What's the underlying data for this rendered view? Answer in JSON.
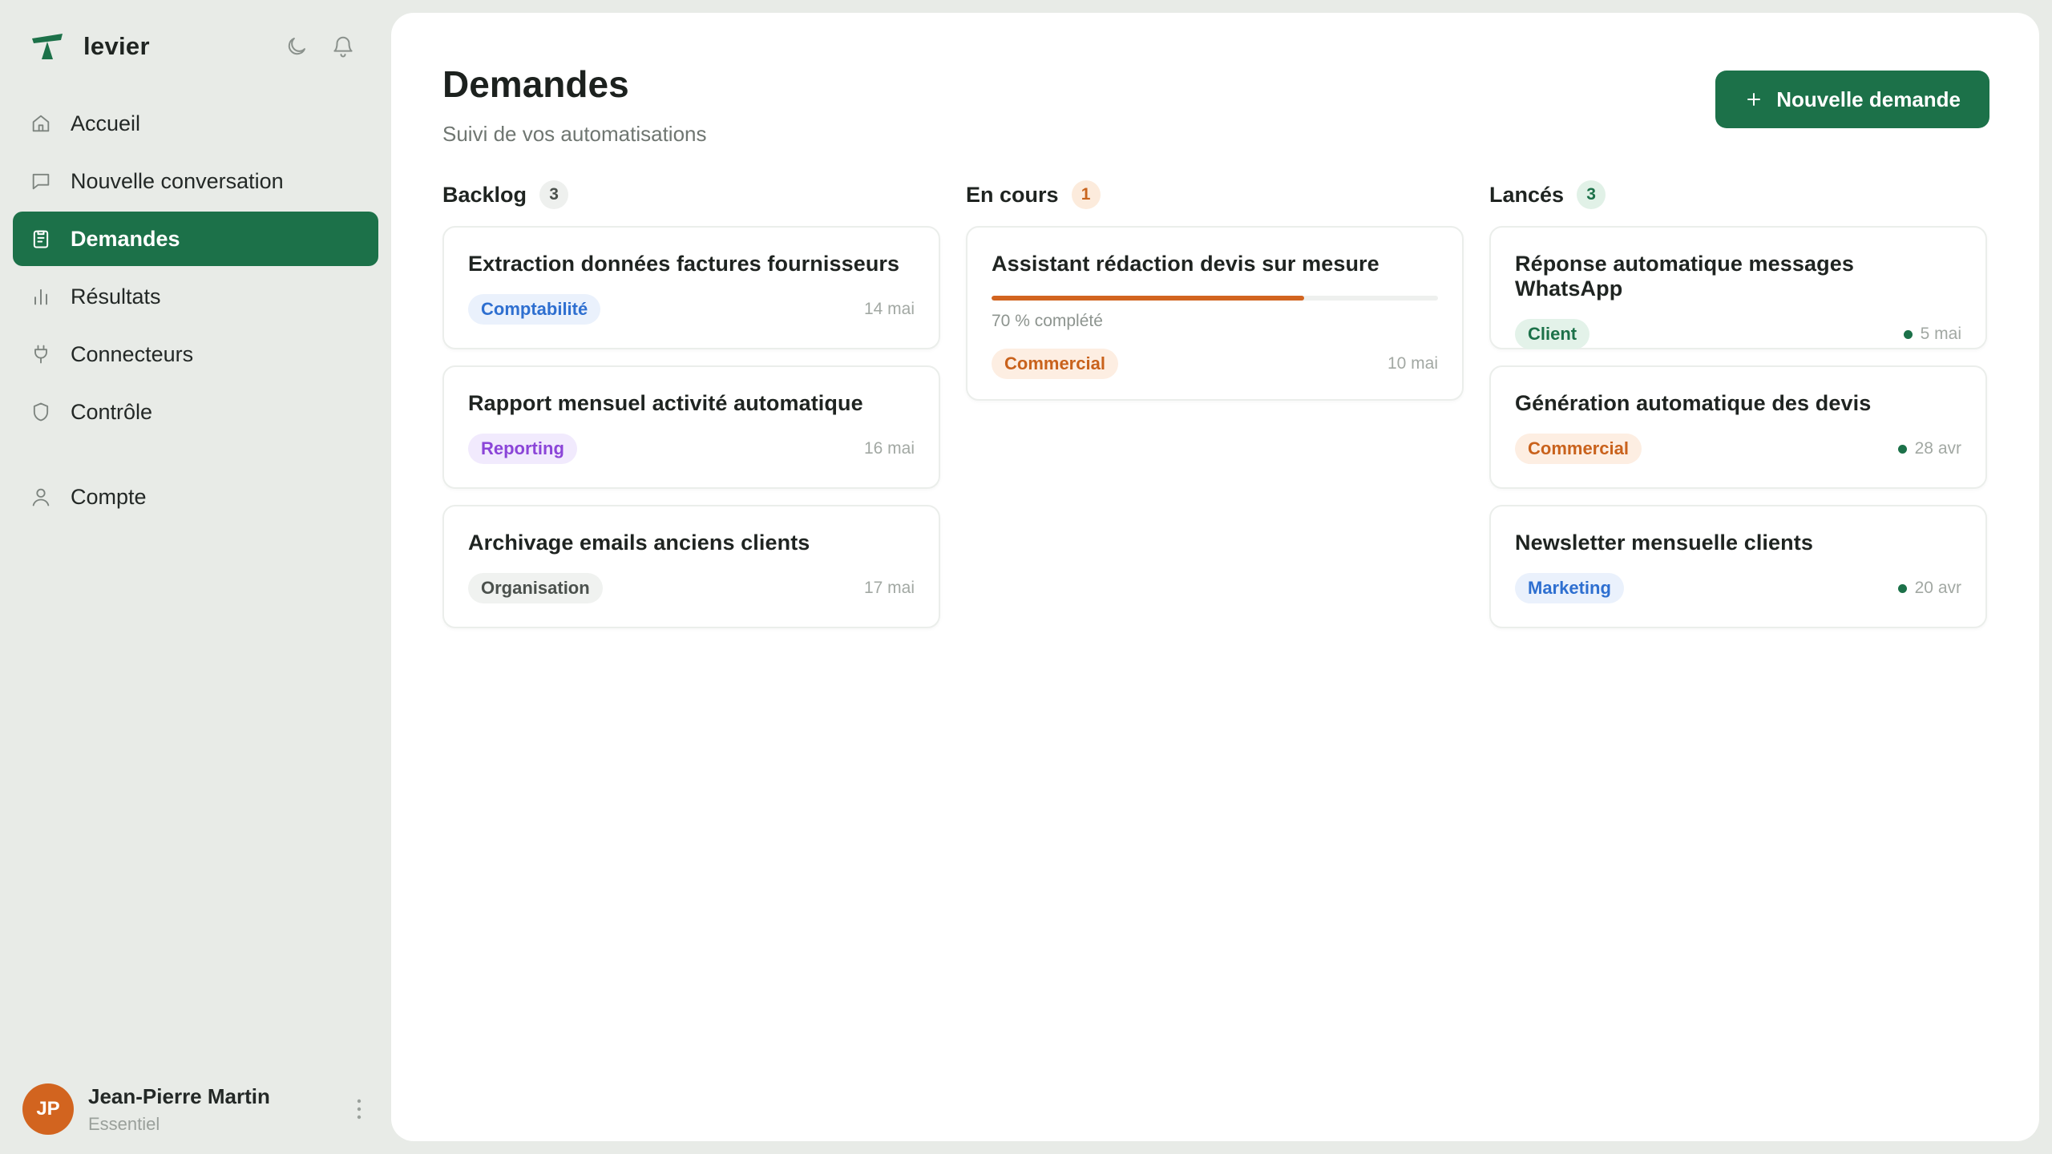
{
  "brand": {
    "name": "levier"
  },
  "sidebar": {
    "items": [
      {
        "label": "Accueil",
        "icon": "home-icon"
      },
      {
        "label": "Nouvelle conversation",
        "icon": "chat-icon"
      },
      {
        "label": "Demandes",
        "icon": "clipboard-icon",
        "active": true
      },
      {
        "label": "Résultats",
        "icon": "bar-chart-icon"
      },
      {
        "label": "Connecteurs",
        "icon": "plug-icon"
      },
      {
        "label": "Contrôle",
        "icon": "shield-icon"
      },
      {
        "label": "Compte",
        "icon": "user-icon"
      }
    ]
  },
  "user": {
    "initials": "JP",
    "name": "Jean-Pierre Martin",
    "plan": "Essentiel"
  },
  "header": {
    "title": "Demandes",
    "subtitle": "Suivi de vos automatisations",
    "new_button_label": "Nouvelle demande"
  },
  "columns": {
    "backlog": {
      "title": "Backlog",
      "count": "3",
      "cards": [
        {
          "title": "Extraction données factures fournisseurs",
          "tag": "Comptabilité",
          "date": "14 mai"
        },
        {
          "title": "Rapport mensuel activité automatique",
          "tag": "Reporting",
          "date": "16 mai"
        },
        {
          "title": "Archivage emails anciens clients",
          "tag": "Organisation",
          "date": "17 mai"
        }
      ]
    },
    "encours": {
      "title": "En cours",
      "count": "1",
      "cards": [
        {
          "title": "Assistant rédaction devis sur mesure",
          "progress": 0.7,
          "progress_label": "70 % complété",
          "tag": "Commercial",
          "date": "10 mai"
        }
      ]
    },
    "lances": {
      "title": "Lancés",
      "count": "3",
      "cards": [
        {
          "title": "Réponse automatique messages WhatsApp",
          "tag": "Client",
          "date": "5 mai"
        },
        {
          "title": "Génération automatique des devis",
          "tag": "Commercial",
          "date": "28 avr"
        },
        {
          "title": "Newsletter mensuelle clients",
          "tag": "Marketing",
          "date": "20 avr"
        }
      ]
    }
  },
  "colors": {
    "brand_green": "#1c7149",
    "accent_orange": "#d2641f"
  }
}
